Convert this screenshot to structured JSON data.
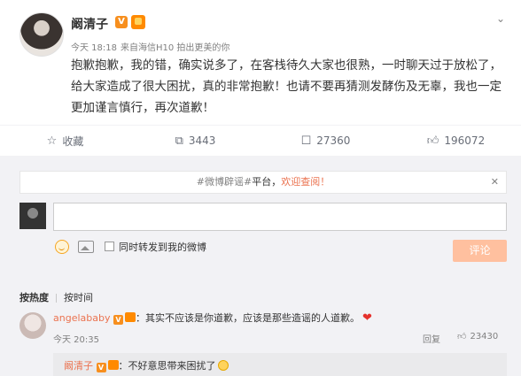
{
  "post": {
    "author": "阚清子",
    "v_badge": "V",
    "meta": {
      "time": "今天 18:18",
      "source": "来自海信H10 拍出更美的你"
    },
    "content": "抱歉抱歉，我的错，确实说多了，在客栈待久大家也很熟，一时聊天过于放松了，给大家造成了很大困扰，真的非常抱歉！也请不要再猜测发酵伤及无辜，我也一定更加谨言慎行，再次道歉！"
  },
  "actions": {
    "favorite": "收藏",
    "repost": "3443",
    "comment": "27360",
    "like": "196072"
  },
  "comment_area": {
    "notice": {
      "hashtag": "#微博辟谣#",
      "text": "平台，",
      "link": "欢迎查阅！"
    },
    "repost_checkbox_label": "同时转发到我的微博",
    "submit_label": "评论"
  },
  "tabs": {
    "hot": "按热度",
    "time": "按时间"
  },
  "comments": [
    {
      "user": "angelababy",
      "text": "：其实不应该是你道歉，应该是那些造谣的人道歉。",
      "time": "今天 20:35",
      "reply_label": "回复",
      "likes": "23430",
      "replies": [
        {
          "user": "阚清子",
          "text": "：不好意思带来困扰了"
        }
      ]
    }
  ],
  "colors": {
    "accent": "#eb7350",
    "button_disabled": "#ffc09f",
    "background": "#f2f2f5",
    "heart": "#e5322d"
  }
}
